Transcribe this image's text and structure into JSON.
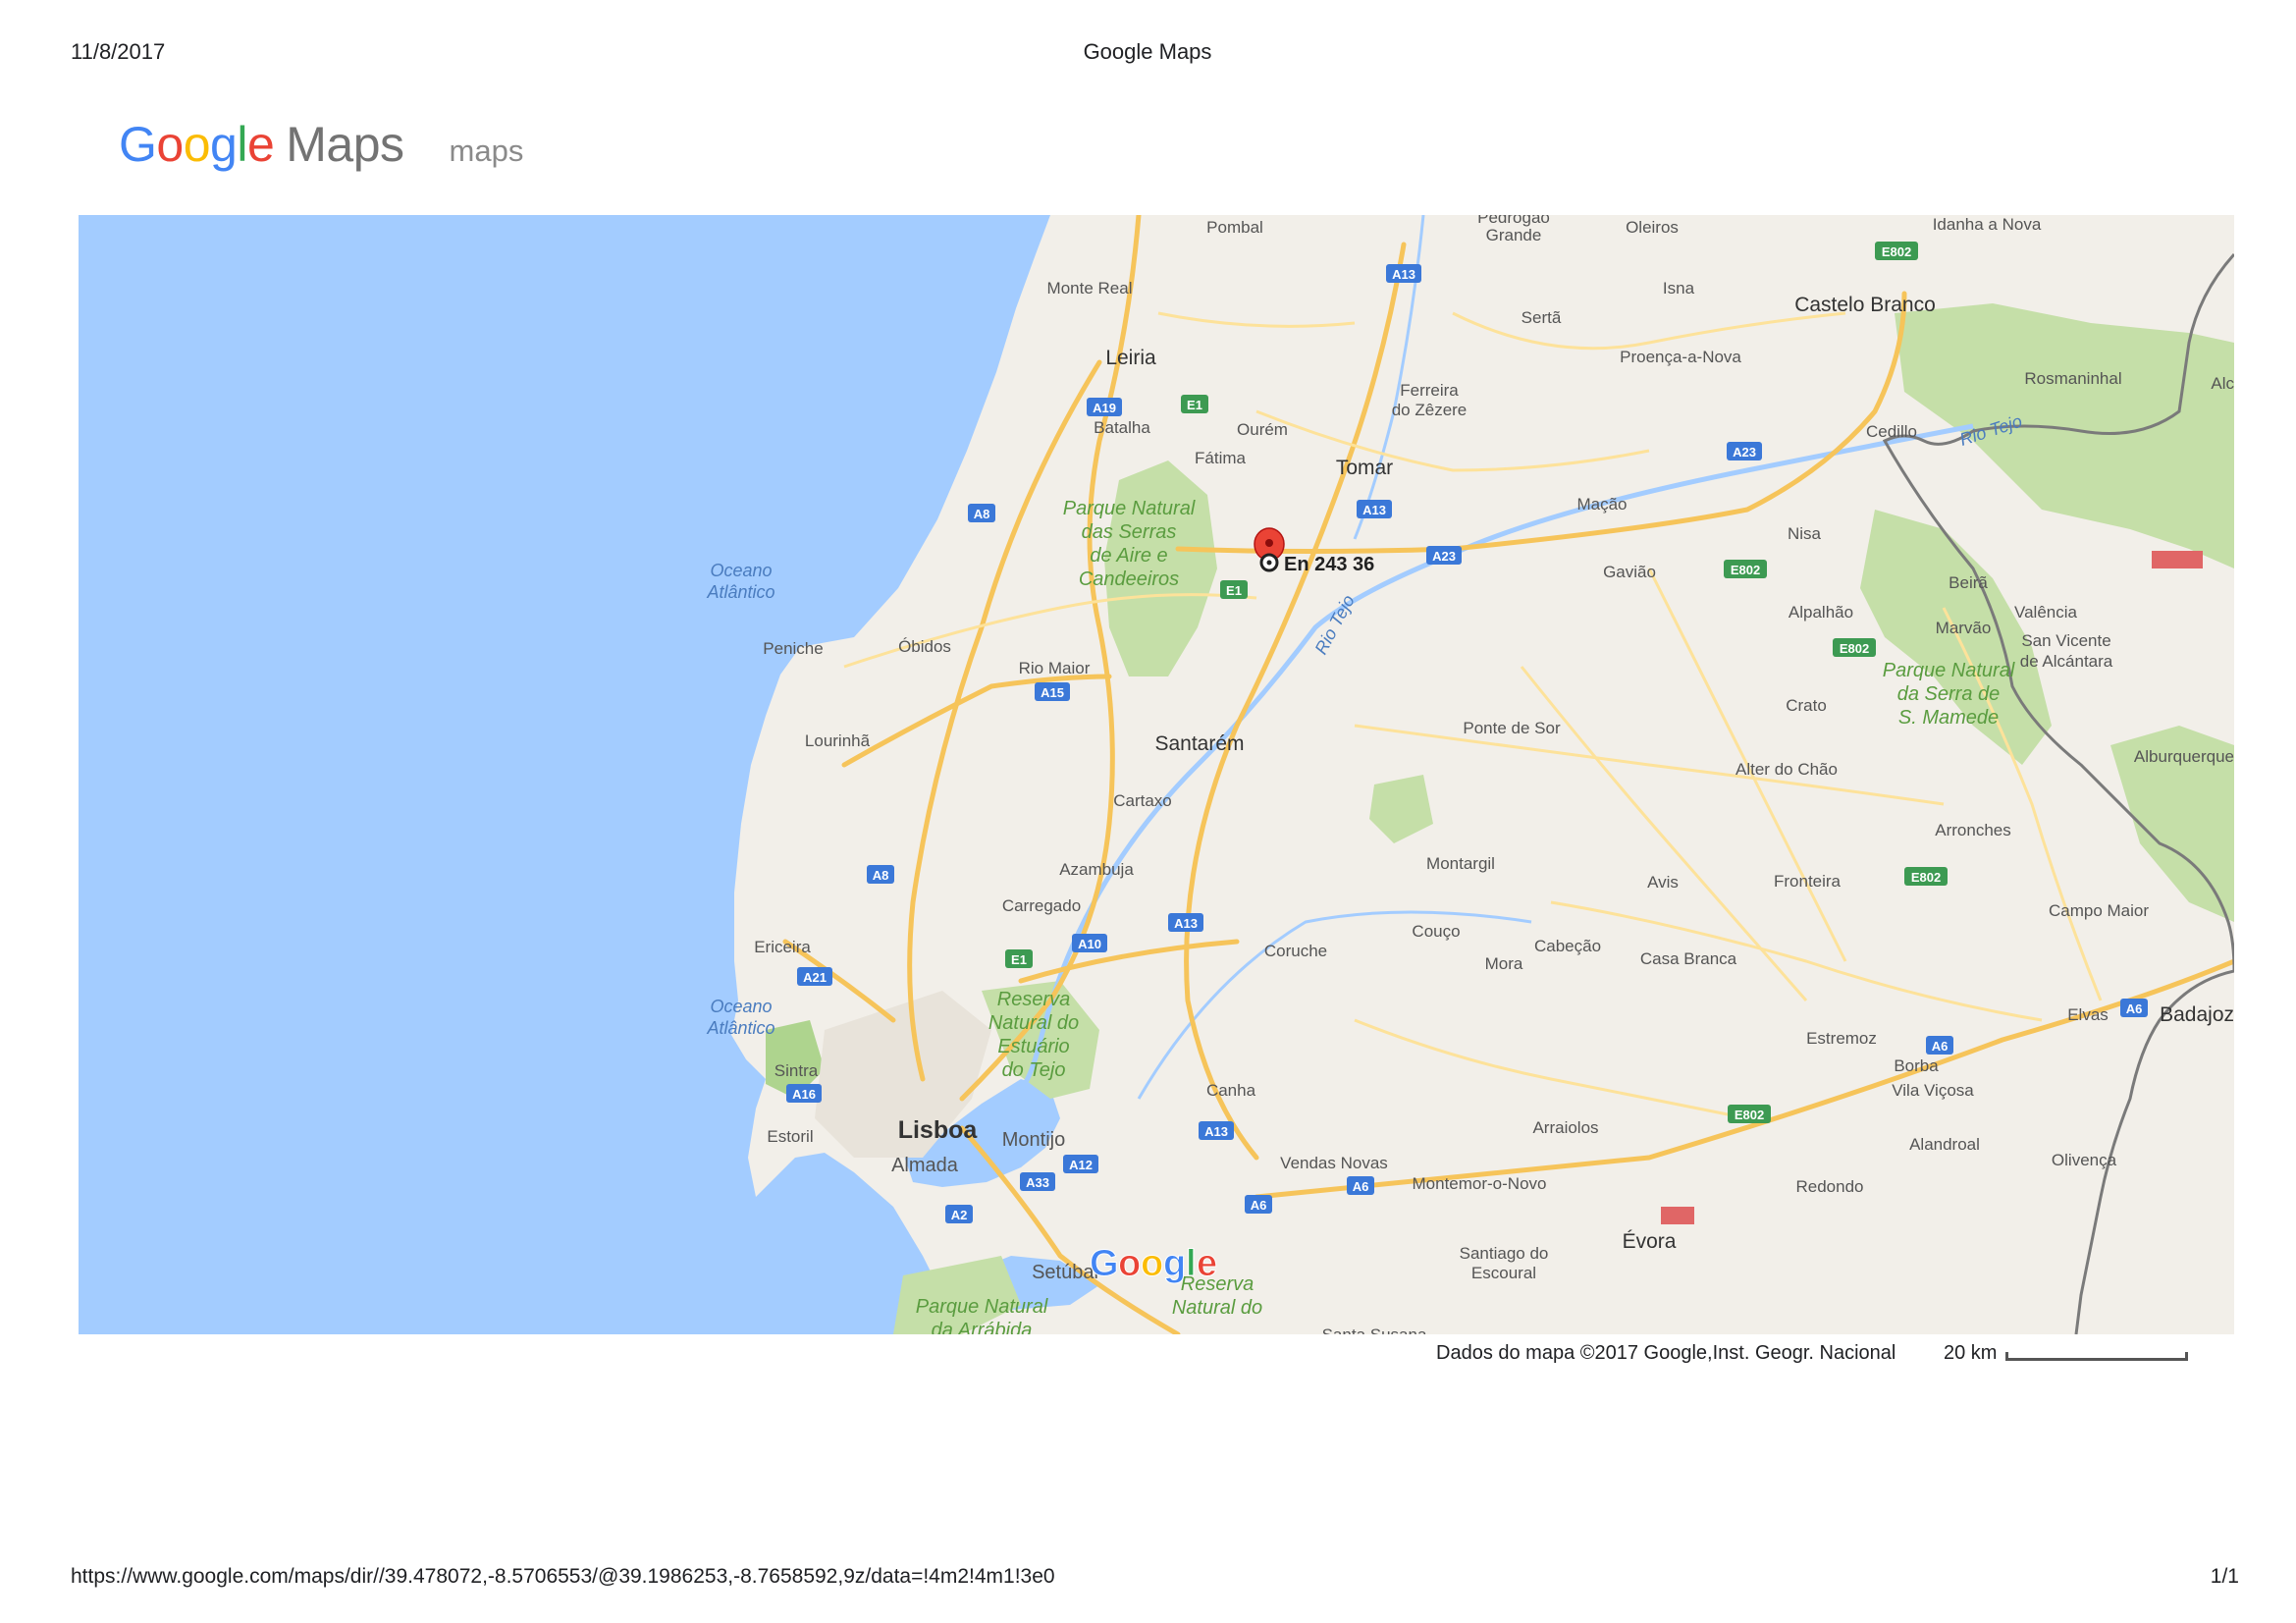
{
  "print_header": {
    "date": "11/8/2017",
    "title": "Google Maps"
  },
  "print_footer": {
    "url": "https://www.google.com/maps/dir//39.478072,-8.5706553/@39.1986253,-8.7658592,9z/data=!4m2!4m1!3e0",
    "page": "1/1"
  },
  "brand": {
    "logo_letters": [
      {
        "ch": "G",
        "color": "#4285F4"
      },
      {
        "ch": "o",
        "color": "#EA4335"
      },
      {
        "ch": "o",
        "color": "#FBBC05"
      },
      {
        "ch": "g",
        "color": "#4285F4"
      },
      {
        "ch": "l",
        "color": "#34A853"
      },
      {
        "ch": "e",
        "color": "#EA4335"
      }
    ],
    "logo_suffix": "Maps",
    "subtitle": "maps"
  },
  "map": {
    "watermark": "Google",
    "marker_label": "En 243 36",
    "water_labels": [
      "Oceano Atlântico",
      "Oceano Atlântico",
      "Rio Tejo",
      "Rio Tejo"
    ],
    "park_labels": [
      "Parque Natural das Serras de Aire e Candeeiros",
      "Parque Natural da Serra de S. Mamede",
      "Reserva Natural do Estuário do Tejo",
      "Parque Natural da Arrábida",
      "Reserva Natural do"
    ],
    "places_major": [
      "Leiria",
      "Santarém",
      "Lisboa",
      "Castelo Branco",
      "Évora",
      "Badajoz",
      "Tomar"
    ],
    "places": [
      "Pombal",
      "Pedrogão Grande",
      "Oleiros",
      "Idanha a Nova",
      "Monte Real",
      "Isna",
      "Sertã",
      "Proença-a-Nova",
      "Ferreira do Zêzere",
      "Rosmaninhal",
      "Alc",
      "Batalha",
      "Ourém",
      "Cedillo",
      "Fátima",
      "Mação",
      "Nisa",
      "Gavião",
      "Beirã",
      "Valência",
      "Alpalhão",
      "Marvão",
      "San Vicente de Alcántara",
      "Peniche",
      "Óbidos",
      "Rio Maior",
      "Crato",
      "Lourinhã",
      "Ponte de Sor",
      "Alter do Chão",
      "Alburquerque",
      "Cartaxo",
      "Azambuja",
      "Arronches",
      "Montargil",
      "Avis",
      "Fronteira",
      "Carregado",
      "Campo Maior",
      "Ericeira",
      "Coruche",
      "Couço",
      "Cabeção",
      "Mora",
      "Casa Branca",
      "Elvas",
      "Estremoz",
      "Borba",
      "Vila Viçosa",
      "Sintra",
      "Canha",
      "Estoril",
      "Montijo",
      "Arraiolos",
      "Alandroal",
      "Almada",
      "Vendas Novas",
      "Olivença",
      "Montemor-o-Novo",
      "Redondo",
      "Setúbal",
      "Santiago do Escoural",
      "Santa Susana"
    ],
    "road_shields": [
      {
        "label": "A13",
        "color": "#3b78d8"
      },
      {
        "label": "E802",
        "color": "#3d9a52"
      },
      {
        "label": "A19",
        "color": "#3b78d8"
      },
      {
        "label": "E1",
        "color": "#3d9a52"
      },
      {
        "label": "A23",
        "color": "#3b78d8"
      },
      {
        "label": "A8",
        "color": "#3b78d8"
      },
      {
        "label": "A13",
        "color": "#3b78d8"
      },
      {
        "label": "A23",
        "color": "#3b78d8"
      },
      {
        "label": "E1",
        "color": "#3d9a52"
      },
      {
        "label": "E802",
        "color": "#3d9a52"
      },
      {
        "label": "E802",
        "color": "#3d9a52"
      },
      {
        "label": "A15",
        "color": "#3b78d8"
      },
      {
        "label": "A8",
        "color": "#3b78d8"
      },
      {
        "label": "E802",
        "color": "#3d9a52"
      },
      {
        "label": "A10",
        "color": "#3b78d8"
      },
      {
        "label": "A13",
        "color": "#3b78d8"
      },
      {
        "label": "E1",
        "color": "#3d9a52"
      },
      {
        "label": "A21",
        "color": "#3b78d8"
      },
      {
        "label": "A6",
        "color": "#3b78d8"
      },
      {
        "label": "A6",
        "color": "#3b78d8"
      },
      {
        "label": "A16",
        "color": "#3b78d8"
      },
      {
        "label": "E802",
        "color": "#3d9a52"
      },
      {
        "label": "A13",
        "color": "#3b78d8"
      },
      {
        "label": "A33",
        "color": "#3b78d8"
      },
      {
        "label": "A12",
        "color": "#3b78d8"
      },
      {
        "label": "A6",
        "color": "#3b78d8"
      },
      {
        "label": "A6",
        "color": "#3b78d8"
      },
      {
        "label": "A2",
        "color": "#3b78d8"
      }
    ],
    "colors": {
      "sea": "#a3ccff",
      "land": "#f2efe9",
      "park": "#c5dfa8",
      "park_dark": "#aed48e",
      "urban": "#e8e3da",
      "motorway": "#f6c45a",
      "road": "#fde29a",
      "river": "#a3ccff",
      "border": "#7a7a7a",
      "marker": "#ea4335",
      "highlight": "#e06666"
    }
  },
  "attribution": "Dados do mapa ©2017 Google,Inst. Geogr. Nacional",
  "scale": {
    "label": "20 km"
  }
}
